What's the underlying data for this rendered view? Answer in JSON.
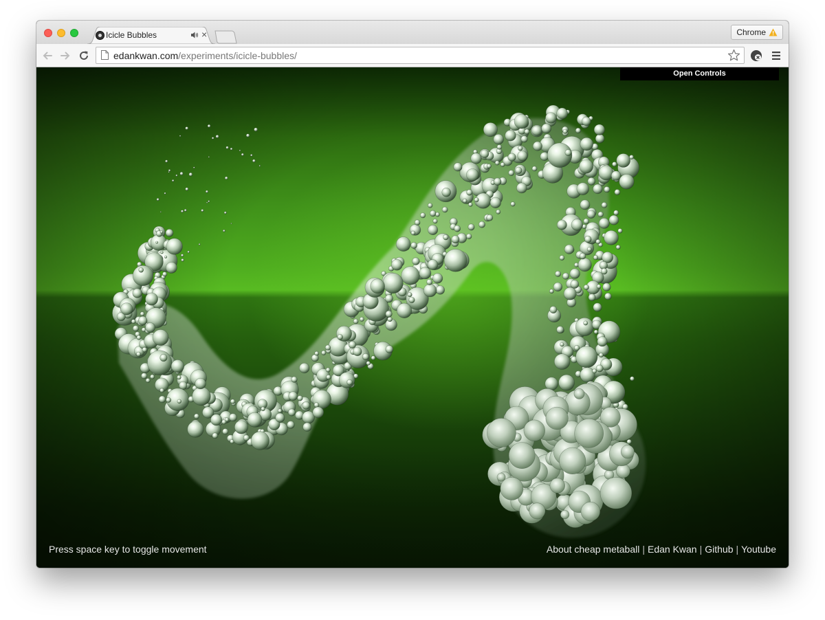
{
  "browser": {
    "tab": {
      "title": "Icicle Bubbles",
      "close_glyph": "×"
    },
    "badge": {
      "label": "Chrome"
    },
    "address": {
      "host": "edankwan.com",
      "path": "/experiments/icicle-bubbles/"
    }
  },
  "page": {
    "controls_label": "Open Controls",
    "hint": "Press space key to toggle movement",
    "footer": {
      "links": [
        "About cheap metaball",
        "Edan Kwan",
        "Github",
        "Youtube"
      ],
      "separator": "|"
    },
    "colors": {
      "background_green": "#4fad1f",
      "controls_bg": "#000000"
    }
  },
  "icons": {
    "traffic_lights": [
      "close-dot",
      "minimize-dot",
      "maximize-dot"
    ],
    "toolbar": [
      "back-arrow-icon",
      "forward-arrow-icon",
      "reload-icon",
      "page-icon",
      "bookmark-star-icon",
      "extension-icon",
      "menu-icon"
    ],
    "tab": [
      "favicon",
      "speaker-icon"
    ],
    "badge": "warning-icon"
  }
}
